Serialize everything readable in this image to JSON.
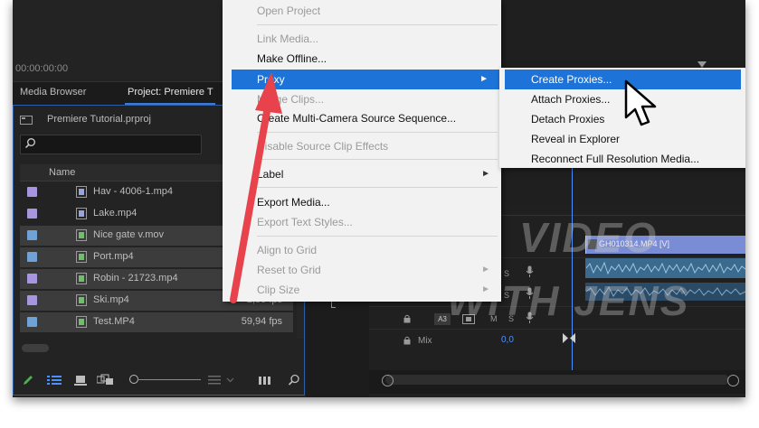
{
  "project_panel": {
    "timecode": "00:00:00:00",
    "tabs": [
      {
        "label": "Media Browser"
      },
      {
        "label": "Project: Premiere T"
      }
    ],
    "project_file": "Premiere Tutorial.prproj",
    "column_name": "Name",
    "items": [
      {
        "name": "Hav - 4006-1.mp4",
        "fps": "",
        "color": "#a895e0",
        "selected": false
      },
      {
        "name": "Lake.mp4",
        "fps": "",
        "color": "#a895e0",
        "selected": false
      },
      {
        "name": "Nice gate v.mov",
        "fps": "",
        "color": "#6fa2d6",
        "selected": true
      },
      {
        "name": "Port.mp4",
        "fps": "",
        "color": "#6fa2d6",
        "selected": true
      },
      {
        "name": "Robin - 21723.mp4",
        "fps": "",
        "color": "#a895e0",
        "selected": true
      },
      {
        "name": "Ski.mp4",
        "fps": "2,50 fps",
        "color": "#a895e0",
        "selected": true
      },
      {
        "name": "Test.MP4",
        "fps": "59,94 fps",
        "color": "#6fa2d6",
        "selected": true
      }
    ]
  },
  "context_menu": {
    "items": [
      {
        "label": "Open Project",
        "disabled": true,
        "submenu": false,
        "highlighted": false
      },
      {
        "label": "Link Media...",
        "disabled": true,
        "submenu": false,
        "highlighted": false
      },
      {
        "label": "Make Offline...",
        "disabled": false,
        "submenu": false,
        "highlighted": false
      },
      {
        "label": "Proxy",
        "disabled": false,
        "submenu": true,
        "highlighted": true
      },
      {
        "label": "Merge Clips...",
        "disabled": true,
        "submenu": false,
        "highlighted": false
      },
      {
        "label": "Create Multi-Camera Source Sequence...",
        "disabled": false,
        "submenu": false,
        "highlighted": false
      },
      {
        "label": "Disable Source Clip Effects",
        "disabled": true,
        "submenu": false,
        "highlighted": false
      },
      {
        "label": "Label",
        "disabled": false,
        "submenu": true,
        "highlighted": false
      },
      {
        "label": "Export Media...",
        "disabled": false,
        "submenu": false,
        "highlighted": false
      },
      {
        "label": "Export Text Styles...",
        "disabled": true,
        "submenu": false,
        "highlighted": false
      },
      {
        "label": "Align to Grid",
        "disabled": true,
        "submenu": false,
        "highlighted": false
      },
      {
        "label": "Reset to Grid",
        "disabled": true,
        "submenu": true,
        "highlighted": false
      },
      {
        "label": "Clip Size",
        "disabled": true,
        "submenu": true,
        "highlighted": false
      }
    ]
  },
  "proxy_submenu": {
    "items": [
      {
        "label": "Create Proxies...",
        "highlighted": true
      },
      {
        "label": "Attach Proxies...",
        "highlighted": false
      },
      {
        "label": "Detach Proxies",
        "highlighted": false
      },
      {
        "label": "Reveal in Explorer",
        "highlighted": false
      },
      {
        "label": "Reconnect Full Resolution Media...",
        "highlighted": false
      }
    ]
  },
  "timeline": {
    "clip_label": "GH010314.MP4 [V]",
    "track_a3": "A3",
    "mute": "M",
    "solo": "S",
    "mix_label": "Mix",
    "mix_value": "0,0"
  },
  "watermark": {
    "line1": "VIDEO",
    "line2": "WITH JENS"
  },
  "colors": {
    "accent": "#1e73d8",
    "annotation_arrow": "#e8434c",
    "playhead": "#4a90ff"
  }
}
